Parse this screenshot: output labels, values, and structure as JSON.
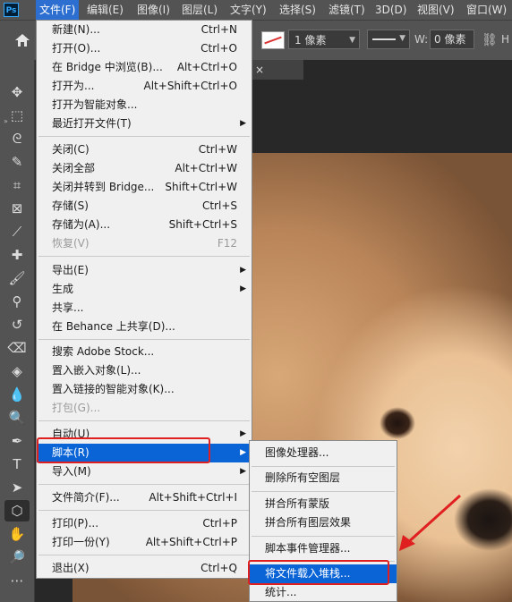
{
  "app": {
    "logo": "Ps"
  },
  "menubar": {
    "items": [
      "文件(F)",
      "编辑(E)",
      "图像(I)",
      "图层(L)",
      "文字(Y)",
      "选择(S)",
      "滤镜(T)",
      "3D(D)",
      "视图(V)",
      "窗口(W)"
    ]
  },
  "options": {
    "size_value": "1 像素",
    "w_label": "W:",
    "w_value": "0 像素",
    "h_label": "H"
  },
  "document": {
    "tab_close": "×"
  },
  "file_menu": {
    "items": [
      {
        "label": "新建(N)...",
        "shortcut": "Ctrl+N"
      },
      {
        "label": "打开(O)...",
        "shortcut": "Ctrl+O"
      },
      {
        "label": "在 Bridge 中浏览(B)...",
        "shortcut": "Alt+Ctrl+O"
      },
      {
        "label": "打开为...",
        "shortcut": "Alt+Shift+Ctrl+O"
      },
      {
        "label": "打开为智能对象...",
        "shortcut": ""
      },
      {
        "label": "最近打开文件(T)",
        "shortcut": ""
      },
      {
        "label": "关闭(C)",
        "shortcut": "Ctrl+W"
      },
      {
        "label": "关闭全部",
        "shortcut": "Alt+Ctrl+W"
      },
      {
        "label": "关闭并转到 Bridge...",
        "shortcut": "Shift+Ctrl+W"
      },
      {
        "label": "存储(S)",
        "shortcut": "Ctrl+S"
      },
      {
        "label": "存储为(A)...",
        "shortcut": "Shift+Ctrl+S"
      },
      {
        "label": "恢复(V)",
        "shortcut": "F12"
      },
      {
        "label": "导出(E)",
        "shortcut": ""
      },
      {
        "label": "生成",
        "shortcut": ""
      },
      {
        "label": "共享...",
        "shortcut": ""
      },
      {
        "label": "在 Behance 上共享(D)...",
        "shortcut": ""
      },
      {
        "label": "搜索 Adobe Stock...",
        "shortcut": ""
      },
      {
        "label": "置入嵌入对象(L)...",
        "shortcut": ""
      },
      {
        "label": "置入链接的智能对象(K)...",
        "shortcut": ""
      },
      {
        "label": "打包(G)...",
        "shortcut": ""
      },
      {
        "label": "自动(U)",
        "shortcut": ""
      },
      {
        "label": "脚本(R)",
        "shortcut": ""
      },
      {
        "label": "导入(M)",
        "shortcut": ""
      },
      {
        "label": "文件简介(F)...",
        "shortcut": "Alt+Shift+Ctrl+I"
      },
      {
        "label": "打印(P)...",
        "shortcut": "Ctrl+P"
      },
      {
        "label": "打印一份(Y)",
        "shortcut": "Alt+Shift+Ctrl+P"
      },
      {
        "label": "退出(X)",
        "shortcut": "Ctrl+Q"
      }
    ]
  },
  "script_submenu": {
    "items": [
      {
        "label": "图像处理器..."
      },
      {
        "label": "删除所有空图层"
      },
      {
        "label": "拼合所有蒙版"
      },
      {
        "label": "拼合所有图层效果"
      },
      {
        "label": "脚本事件管理器..."
      },
      {
        "label": "将文件载入堆栈..."
      },
      {
        "label": "统计..."
      }
    ]
  },
  "colors": {
    "highlight": "#0a64d6",
    "annotation": "#e02020"
  }
}
